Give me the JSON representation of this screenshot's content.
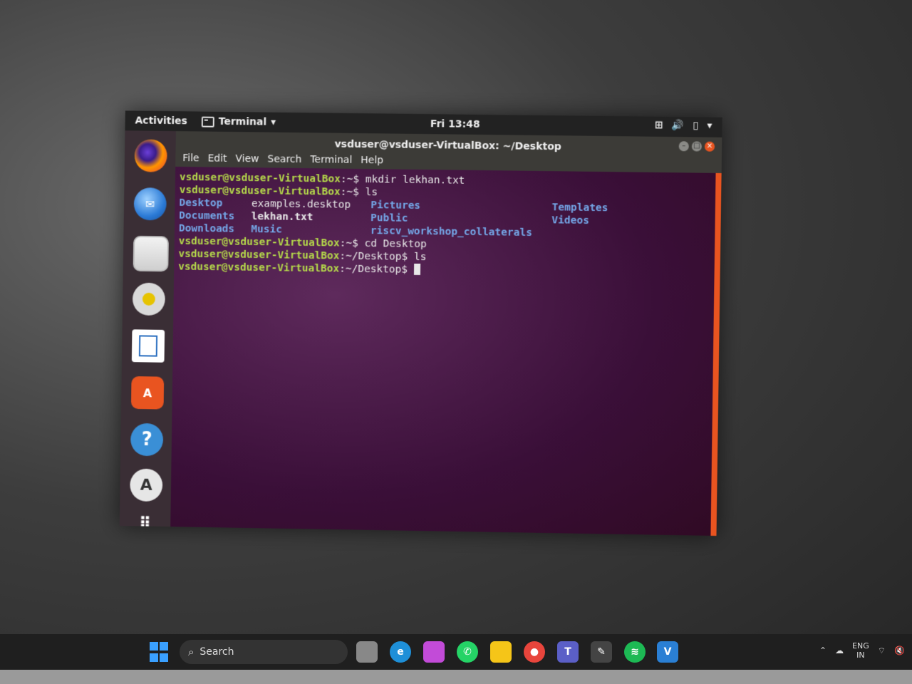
{
  "ubuntu": {
    "topbar": {
      "activities": "Activities",
      "app_menu": "Terminal",
      "clock": "Fri 13:48"
    },
    "dock": {
      "items": [
        "firefox-icon",
        "thunderbird-icon",
        "files-icon",
        "rhythmbox-icon",
        "writer-icon",
        "software-icon",
        "help-icon",
        "update-icon",
        "apps-grid-icon"
      ]
    },
    "window": {
      "title": "vsduser@vsduser-VirtualBox: ~/Desktop",
      "menus": [
        "File",
        "Edit",
        "View",
        "Search",
        "Terminal",
        "Help"
      ]
    },
    "terminal": {
      "lines": [
        {
          "prompt": "vsduser@vsduser-VirtualBox",
          "path": ":~$",
          "cmd": " mkdir lekhan.txt"
        },
        {
          "prompt": "vsduser@vsduser-VirtualBox",
          "path": ":~$",
          "cmd": " ls"
        }
      ],
      "ls_rows": [
        [
          "Desktop",
          "examples.desktop",
          "Pictures",
          "Templates"
        ],
        [
          "Documents",
          "lekhan.txt",
          "Public",
          "Videos"
        ],
        [
          "Downloads",
          "Music",
          "riscv_workshop_collaterals",
          ""
        ]
      ],
      "lines_after": [
        {
          "prompt": "vsduser@vsduser-VirtualBox",
          "path": ":~$",
          "cmd": " cd Desktop"
        },
        {
          "prompt": "vsduser@vsduser-VirtualBox",
          "path": ":~/Desktop$",
          "cmd": " ls"
        },
        {
          "prompt": "vsduser@vsduser-VirtualBox",
          "path": ":~/Desktop$",
          "cmd": " "
        }
      ]
    }
  },
  "windows_taskbar": {
    "search_label": "Search",
    "lang_top": "ENG",
    "lang_bottom": "IN"
  },
  "colors": {
    "terminal_bg": "#300a24",
    "prompt": "#b5d94a",
    "directory": "#74a7e8",
    "accent": "#e95420"
  }
}
